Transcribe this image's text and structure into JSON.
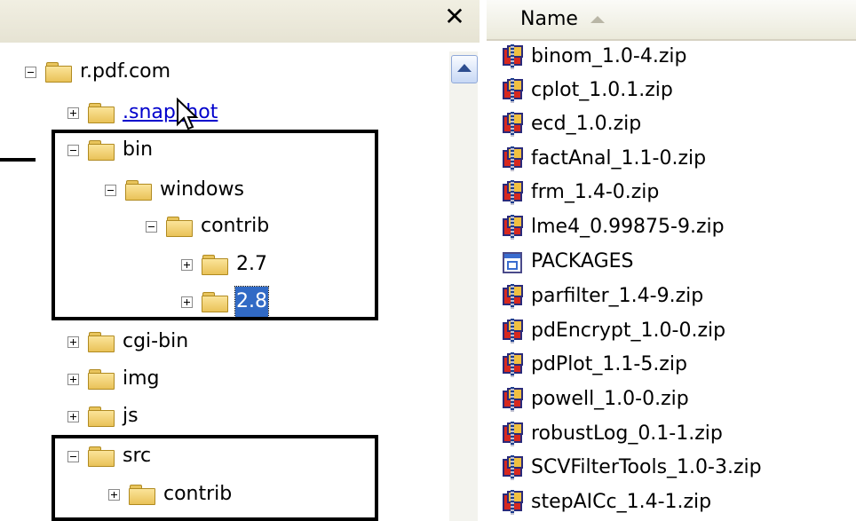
{
  "tree": {
    "close_glyph": "✕",
    "nodes": [
      {
        "label": "r.pdf.com",
        "expander": "minus"
      },
      {
        "label": ".snapshot",
        "expander": "plus"
      },
      {
        "label": "bin",
        "expander": "minus"
      },
      {
        "label": "windows",
        "expander": "minus"
      },
      {
        "label": "contrib",
        "expander": "minus"
      },
      {
        "label": "2.7",
        "expander": "plus"
      },
      {
        "label": "2.8",
        "expander": "plus",
        "selected": true
      },
      {
        "label": "cgi-bin",
        "expander": "plus"
      },
      {
        "label": "img",
        "expander": "plus"
      },
      {
        "label": "js",
        "expander": "plus"
      },
      {
        "label": "src",
        "expander": "minus"
      },
      {
        "label": "contrib",
        "expander": "plus"
      }
    ]
  },
  "list": {
    "column_name": "Name",
    "files": [
      {
        "name": "binom_1.0-4.zip",
        "icon": "zip-archive-icon"
      },
      {
        "name": "cplot_1.0.1.zip",
        "icon": "zip-archive-icon"
      },
      {
        "name": "ecd_1.0.zip",
        "icon": "zip-archive-icon"
      },
      {
        "name": "factAnal_1.1-0.zip",
        "icon": "zip-archive-icon"
      },
      {
        "name": "frm_1.4-0.zip",
        "icon": "zip-archive-icon"
      },
      {
        "name": "lme4_0.99875-9.zip",
        "icon": "zip-archive-icon"
      },
      {
        "name": "PACKAGES",
        "icon": "document-icon"
      },
      {
        "name": "parfilter_1.4-9.zip",
        "icon": "zip-archive-icon"
      },
      {
        "name": "pdEncrypt_1.0-0.zip",
        "icon": "zip-archive-icon"
      },
      {
        "name": "pdPlot_1.1-5.zip",
        "icon": "zip-archive-icon"
      },
      {
        "name": "powell_1.0-0.zip",
        "icon": "zip-archive-icon"
      },
      {
        "name": "robustLog_0.1-1.zip",
        "icon": "zip-archive-icon"
      },
      {
        "name": "SCVFilterTools_1.0-3.zip",
        "icon": "zip-archive-icon"
      },
      {
        "name": "stepAICc_1.4-1.zip",
        "icon": "zip-archive-icon"
      }
    ]
  },
  "colors": {
    "selection": "#316ac5",
    "link": "#0000cc",
    "folder": "#f2cf6b",
    "frame": "#000000"
  }
}
